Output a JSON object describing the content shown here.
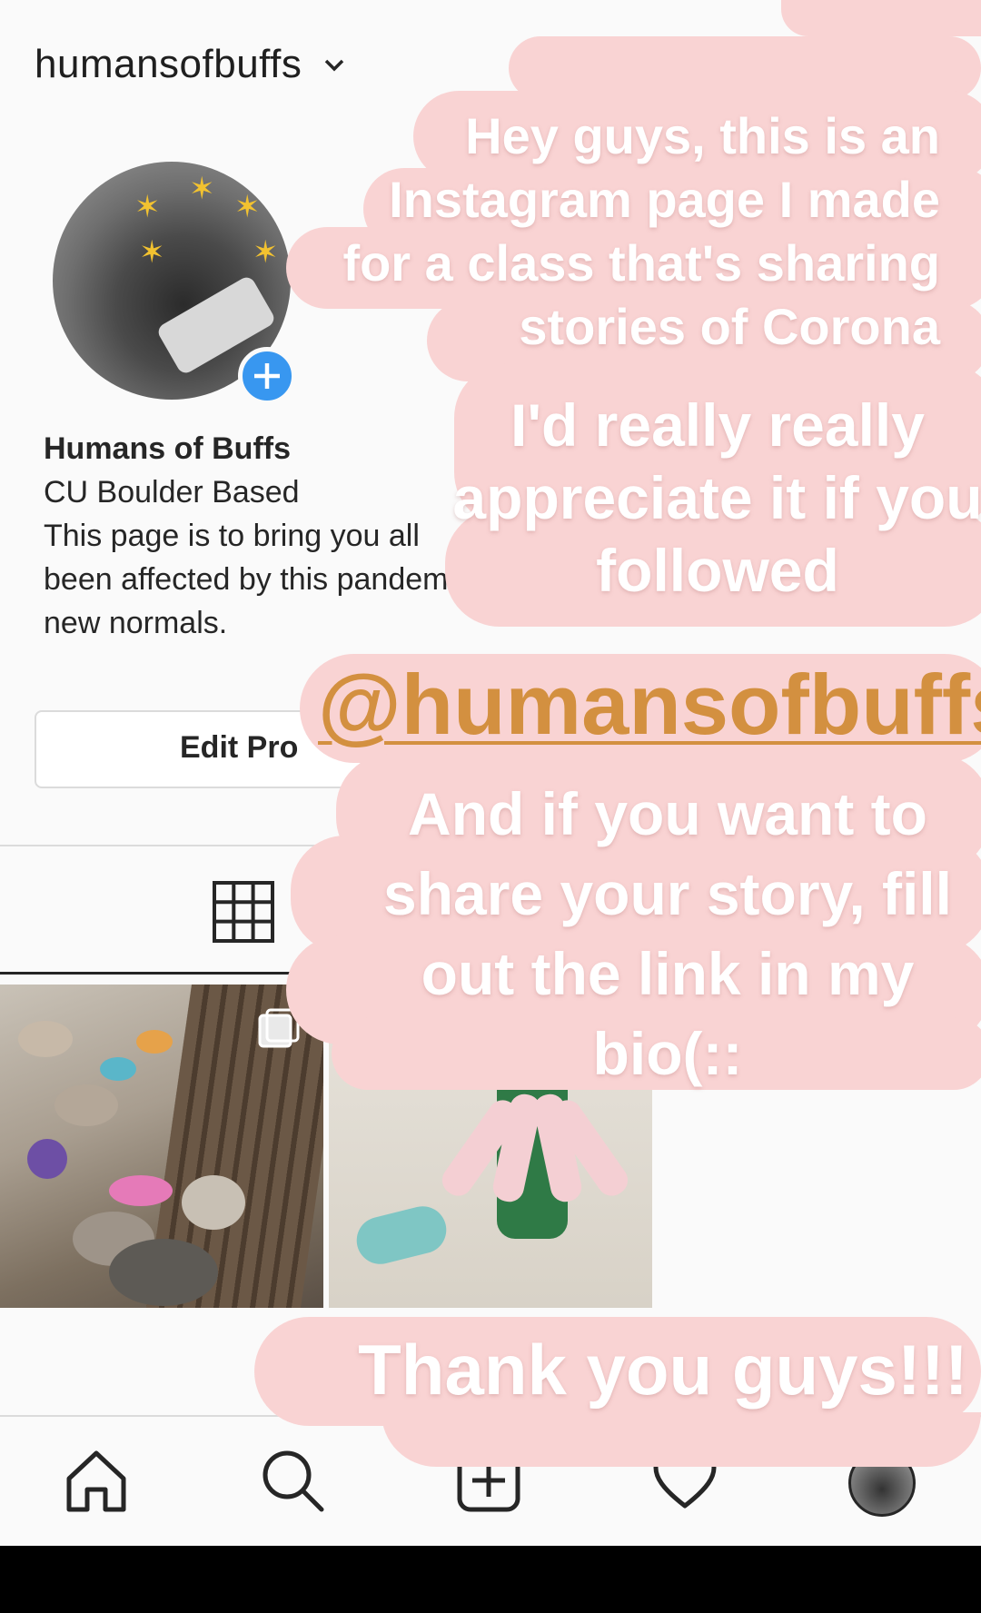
{
  "header": {
    "username": "humansofbuffs"
  },
  "profile": {
    "display_name": "Humans of Buffs",
    "bio_lines": [
      "CU Boulder Based",
      "This page is to bring you all",
      "been affected by this pandem",
      "new normals."
    ],
    "edit_button_label": "Edit Pro"
  },
  "story_overlay": {
    "block1_lines": [
      "Hey guys, this is an",
      "Instagram page I made",
      "for a class that's sharing",
      "stories of Corona"
    ],
    "block2_lines": [
      "I'd really really",
      "appreciate it if you",
      "followed"
    ],
    "handle": "@humansofbuffs",
    "block3_lines": [
      "And if you want to",
      "share your story, fill",
      "out the link in my",
      "bio(::"
    ],
    "thanks": "Thank you guys!!!"
  },
  "colors": {
    "sticker_pink": "#f9d3d3",
    "handle_orange": "#d39040",
    "accent_blue": "#3897f0"
  },
  "icons": [
    "chevron-down-icon",
    "add-story-icon",
    "grid-icon",
    "multi-photo-icon",
    "home-icon",
    "search-icon",
    "new-post-icon",
    "heart-icon",
    "profile-avatar-icon"
  ]
}
